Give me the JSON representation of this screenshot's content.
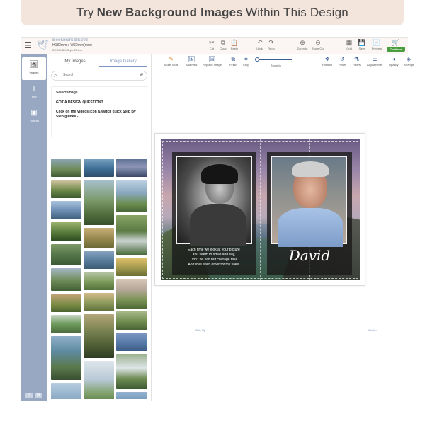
{
  "banner": {
    "prefix": "Try",
    "bold": "New Background Images",
    "suffix": "Within This Design"
  },
  "document": {
    "title": "Bookmark BES08",
    "size": "H180mm x W69mm(mm)",
    "style": "BES08 BM Style 2 New"
  },
  "topbar": {
    "cut": "Cut",
    "copy": "Copy",
    "paste": "Paste",
    "undo": "Undo",
    "redo": "Redo",
    "zoom_in": "Zoom In",
    "zoom_out": "Zoom Out",
    "grid": "Grid",
    "save": "Save",
    "preview": "Preview",
    "continue": "Continue"
  },
  "rail": {
    "images": "Images",
    "text": "Text",
    "tutorial": "Tutorial",
    "foot_icons": [
      "?",
      "⚙"
    ]
  },
  "panel": {
    "tabs": [
      "My Images",
      "Image Gallery"
    ],
    "active_tab": 1,
    "search_placeholder": "Search",
    "select_image": "Select Image",
    "question": "GOT A DESIGN QUESTION?",
    "help": "Click on the Videos icon & watch quick Step By Step guides -"
  },
  "edit_toolbar": {
    "more_tools": "More Tools",
    "add_new": "Add New",
    "replace_image": "Replace Image",
    "finish": "Finish",
    "crop": "Crop",
    "zoom_in": "Zoom In",
    "position": "Position",
    "reset": "Reset",
    "filters": "Filters",
    "adjustments": "Adjustments",
    "opacity": "Opacity",
    "arrange": "Arrange"
  },
  "card": {
    "verse": [
      "Each time we look at your picture",
      "You seem to smile and say,",
      "Don't be sad but courage take",
      "And love each other for my sake."
    ],
    "name": "David",
    "label_left": "Side Up",
    "label_right": "Center"
  },
  "colors": {
    "rail": "#98a8c3",
    "accent": "#7a94bd",
    "continue": "#4a9d3f",
    "banner": "#f3e4dc"
  }
}
